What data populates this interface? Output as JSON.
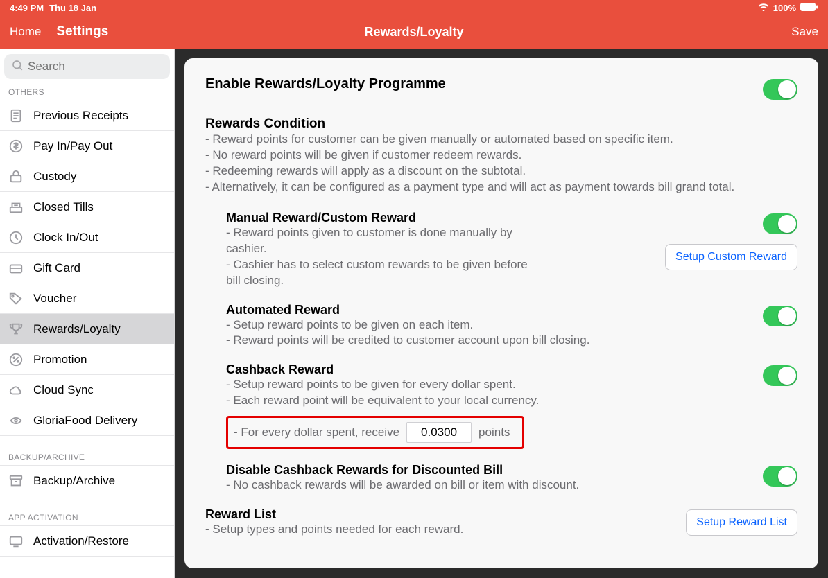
{
  "status": {
    "time": "4:49 PM",
    "date": "Thu 18 Jan",
    "battery": "100%"
  },
  "nav": {
    "home": "Home",
    "settings": "Settings",
    "title": "Rewards/Loyalty",
    "save": "Save"
  },
  "search": {
    "placeholder": "Search"
  },
  "sidebar": {
    "others_header": "OTHERS",
    "backup_header": "BACKUP/ARCHIVE",
    "activation_header": "APP ACTIVATION",
    "items": {
      "previous_receipts": "Previous Receipts",
      "pay_in_out": "Pay In/Pay Out",
      "custody": "Custody",
      "closed_tills": "Closed Tills",
      "clock": "Clock In/Out",
      "gift_card": "Gift Card",
      "voucher": "Voucher",
      "rewards": "Rewards/Loyalty",
      "promotion": "Promotion",
      "cloud_sync": "Cloud Sync",
      "gloriafood": "GloriaFood Delivery",
      "backup": "Backup/Archive",
      "activation": "Activation/Restore"
    }
  },
  "content": {
    "enable": "Enable Rewards/Loyalty Programme",
    "conditions_title": "Rewards Condition",
    "conditions": " - Reward points for customer can be given manually or automated based on specific item.\n - No reward points will be given if customer redeem rewards.\n - Redeeming rewards will apply as a discount on the subtotal.\n - Alternatively, it can be configured as a payment type and will act as payment towards bill grand total.",
    "manual_title": "Manual Reward/Custom Reward",
    "manual_desc": " - Reward points given to customer is done manually by cashier.\n - Cashier has to select custom rewards to be given before bill closing.",
    "setup_custom_btn": "Setup Custom Reward",
    "auto_title": "Automated Reward",
    "auto_desc": " - Setup reward points to be given on each item.\n - Reward points will be credited to customer account upon bill closing.",
    "cashback_title": "Cashback Reward",
    "cashback_desc": " - Setup reward points to be given for every dollar spent.\n - Each reward point will be equivalent to your local currency.",
    "callout_pre": "- For every dollar spent, receive",
    "callout_value": "0.0300",
    "callout_post": "points",
    "disable_title": "Disable Cashback Rewards for Discounted Bill",
    "disable_desc": " - No cashback rewards will be awarded on bill or item with discount.",
    "list_title": "Reward List",
    "list_desc": " - Setup types and points needed for each reward.",
    "setup_list_btn": "Setup Reward List"
  }
}
